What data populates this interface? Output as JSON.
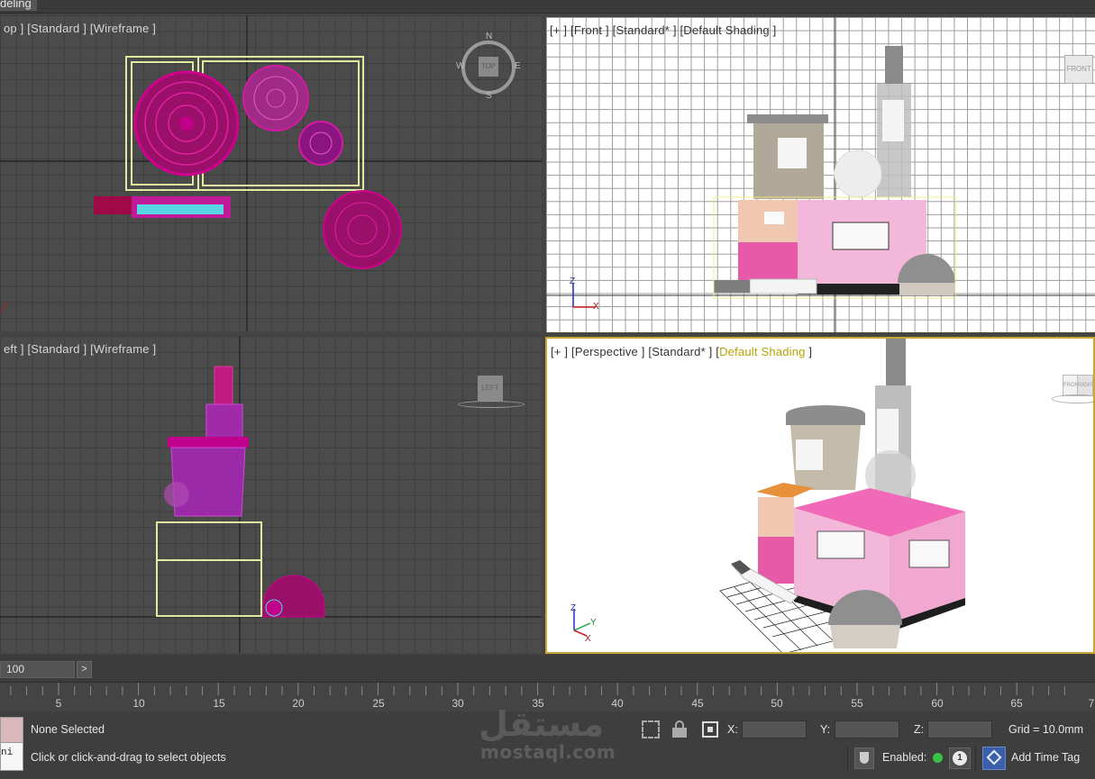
{
  "app": {
    "mode_tab": "deling"
  },
  "viewports": {
    "top": {
      "label": "op ] [Standard ] [Wireframe ]",
      "cube_label": "TOP",
      "compass": {
        "n": "N",
        "s": "S",
        "e": "E",
        "w": "W"
      }
    },
    "front": {
      "label": "[+ ] [Front ] [Standard* ] [Default Shading ]",
      "cube_label": "FRONT"
    },
    "left": {
      "label": "eft ] [Standard ] [Wireframe ]",
      "cube_label": "LEFT"
    },
    "perspective": {
      "label_prefix": "[+ ] [Perspective ] [Standard* ] [",
      "label_highlight": "Default Shading",
      "label_suffix": " ]",
      "cube_labels": [
        "FRONT",
        "RIGHT"
      ]
    }
  },
  "axis_letters": {
    "z": "Z",
    "x": "X",
    "y": "Y"
  },
  "timebar": {
    "frame_field": "100",
    "next_arrow": ">"
  },
  "ruler": {
    "ticks": [
      "5",
      "10",
      "15",
      "20",
      "25",
      "30",
      "35",
      "40",
      "45",
      "50",
      "55",
      "60",
      "65",
      "7"
    ]
  },
  "status": {
    "selection": "None Selected",
    "prompt": "Click or click-and-drag to select objects",
    "script_label": "ni",
    "x_label": "X:",
    "y_label": "Y:",
    "z_label": "Z:",
    "grid": "Grid = 10.0mm",
    "enabled_label": "Enabled:",
    "enabled_count": "1",
    "add_time_tag": "Add Time Tag"
  },
  "watermark": {
    "arabic": "مستقل",
    "latin": "mostaql.com"
  },
  "colors": {
    "accent_yellow": "#c8a832",
    "selection_wire": "#e6eda0",
    "magenta": "#c0008a",
    "status_green": "#39c245"
  }
}
